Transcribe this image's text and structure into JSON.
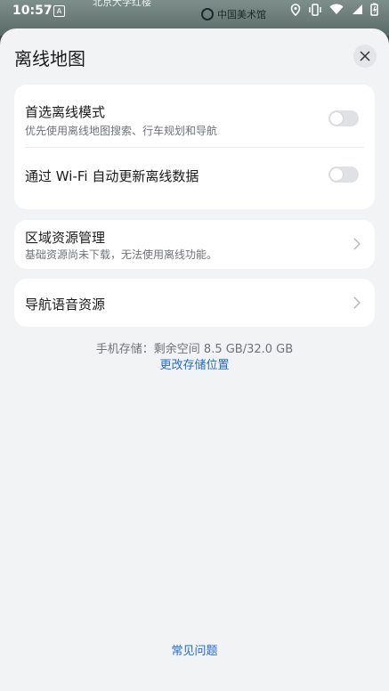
{
  "status": {
    "time": "10:57",
    "notif_glyph": "A",
    "map_label_top": "北京大学红楼",
    "map_label_station": "中国美术馆",
    "icons": [
      "location-icon",
      "vibrate-icon",
      "wifi-icon",
      "signal-icon",
      "battery-icon"
    ]
  },
  "sheet": {
    "title": "离线地图",
    "card1": {
      "row1": {
        "title": "首选离线模式",
        "subtitle": "优先使用离线地图搜索、行车规划和导航",
        "toggle_on": false
      },
      "row2": {
        "title": "通过 Wi-Fi 自动更新离线数据",
        "toggle_on": false
      }
    },
    "card2": {
      "title": "区域资源管理",
      "subtitle": "基础资源尚未下载，无法使用离线功能。"
    },
    "card3": {
      "title": "导航语音资源"
    },
    "storage_text": "手机存储：剩余空间 8.5 GB/32.0 GB",
    "change_location": "更改存储位置",
    "faq": "常见问题"
  },
  "colors": {
    "accent": "#2169d8",
    "sheet_bg": "#f1f3f5",
    "card_bg": "#ffffff",
    "toggle_off": "#dfe1e4"
  }
}
